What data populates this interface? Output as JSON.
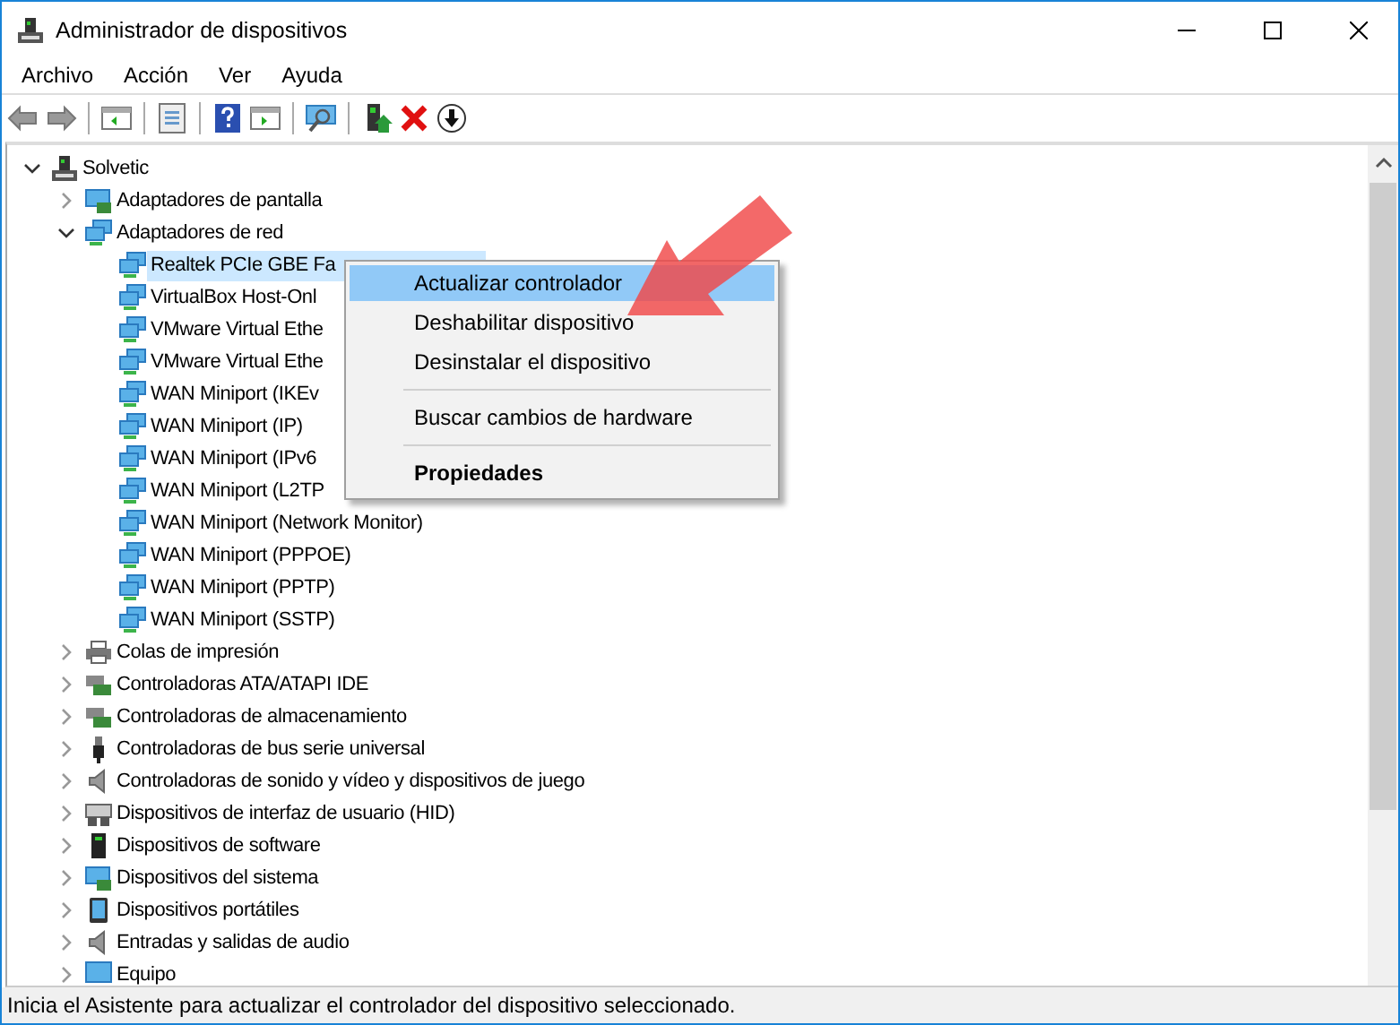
{
  "window": {
    "title": "Administrador de dispositivos"
  },
  "menu_bar": [
    "Archivo",
    "Acción",
    "Ver",
    "Ayuda"
  ],
  "toolbar": [
    {
      "kind": "back"
    },
    {
      "kind": "forward"
    },
    {
      "kind": "sep"
    },
    {
      "kind": "tree"
    },
    {
      "kind": "sep"
    },
    {
      "kind": "props"
    },
    {
      "kind": "sep"
    },
    {
      "kind": "help"
    },
    {
      "kind": "pane"
    },
    {
      "kind": "sep"
    },
    {
      "kind": "scan"
    },
    {
      "kind": "sep"
    },
    {
      "kind": "update"
    },
    {
      "kind": "remove"
    },
    {
      "kind": "disable"
    }
  ],
  "tree": [
    {
      "label": "Solvetic",
      "kind": "computer",
      "expanded": true,
      "selected": false,
      "children": [
        {
          "label": "Adaptadores de pantalla",
          "kind": "display",
          "expanded": false,
          "selected": false
        },
        {
          "label": "Adaptadores de red",
          "kind": "network",
          "expanded": true,
          "selected": false,
          "children": [
            {
              "label": "Realtek PCIe GBE Fa",
              "kind": "network",
              "selected": true
            },
            {
              "label": "VirtualBox Host-Onl",
              "kind": "network",
              "selected": false
            },
            {
              "label": "VMware Virtual Ethe",
              "kind": "network",
              "selected": false
            },
            {
              "label": "VMware Virtual Ethe",
              "kind": "network",
              "selected": false
            },
            {
              "label": "WAN Miniport (IKEv",
              "kind": "network",
              "selected": false
            },
            {
              "label": "WAN Miniport (IP)",
              "kind": "network",
              "selected": false
            },
            {
              "label": "WAN Miniport (IPv6",
              "kind": "network",
              "selected": false
            },
            {
              "label": "WAN Miniport (L2TP",
              "kind": "network",
              "selected": false
            },
            {
              "label": "WAN Miniport (Network Monitor)",
              "kind": "network",
              "selected": false
            },
            {
              "label": "WAN Miniport (PPPOE)",
              "kind": "network",
              "selected": false
            },
            {
              "label": "WAN Miniport (PPTP)",
              "kind": "network",
              "selected": false
            },
            {
              "label": "WAN Miniport (SSTP)",
              "kind": "network",
              "selected": false
            }
          ]
        },
        {
          "label": "Colas de impresión",
          "kind": "printer",
          "expanded": false,
          "selected": false
        },
        {
          "label": "Controladoras ATA/ATAPI IDE",
          "kind": "card",
          "expanded": false,
          "selected": false
        },
        {
          "label": "Controladoras de almacenamiento",
          "kind": "card",
          "expanded": false,
          "selected": false
        },
        {
          "label": "Controladoras de bus serie universal",
          "kind": "usb",
          "expanded": false,
          "selected": false
        },
        {
          "label": "Controladoras de sonido y vídeo y dispositivos de juego",
          "kind": "speaker",
          "expanded": false,
          "selected": false
        },
        {
          "label": "Dispositivos de interfaz de usuario (HID)",
          "kind": "keyboard",
          "expanded": false,
          "selected": false
        },
        {
          "label": "Dispositivos de software",
          "kind": "tower",
          "expanded": false,
          "selected": false
        },
        {
          "label": "Dispositivos del sistema",
          "kind": "display",
          "expanded": false,
          "selected": false
        },
        {
          "label": "Dispositivos portátiles",
          "kind": "portable",
          "expanded": false,
          "selected": false
        },
        {
          "label": "Entradas y salidas de audio",
          "kind": "speaker",
          "expanded": false,
          "selected": false
        },
        {
          "label": "Equipo",
          "kind": "monitor",
          "expanded": false,
          "selected": false
        }
      ]
    }
  ],
  "context_menu": [
    {
      "kind": "item",
      "label": "Actualizar controlador",
      "selected": true,
      "default": false
    },
    {
      "kind": "item",
      "label": "Deshabilitar dispositivo",
      "selected": false,
      "default": false
    },
    {
      "kind": "item",
      "label": "Desinstalar el dispositivo",
      "selected": false,
      "default": false
    },
    {
      "kind": "separator"
    },
    {
      "kind": "item",
      "label": "Buscar cambios de hardware",
      "selected": false,
      "default": false
    },
    {
      "kind": "separator"
    },
    {
      "kind": "item",
      "label": "Propiedades",
      "selected": false,
      "default": true
    }
  ],
  "status_bar": "Inicia el Asistente para actualizar el controlador del dispositivo seleccionado."
}
